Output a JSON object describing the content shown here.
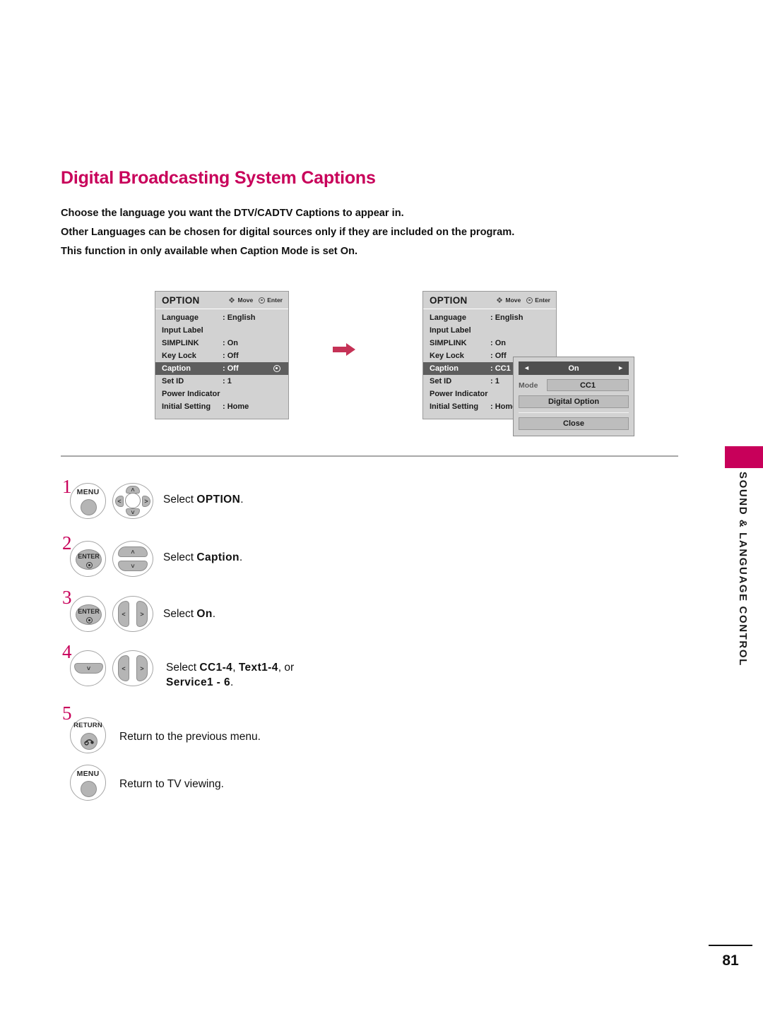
{
  "page": {
    "title": "Digital Broadcasting System Captions",
    "number": "81",
    "sidebar_label": "SOUND & LANGUAGE CONTROL"
  },
  "intro": {
    "line1": "Choose the language you want the DTV/CADTV Captions to appear in.",
    "line2": "Other Languages can be chosen for digital sources only if they are included on the program.",
    "line3_a": "This function in only available when ",
    "line3_b": "Caption",
    "line3_c": " Mode is set ",
    "line3_d": "On",
    "line3_e": "."
  },
  "osd_left": {
    "title": "OPTION",
    "hint_move": "Move",
    "hint_enter": "Enter",
    "rows": [
      {
        "label": "Language",
        "value": ": English"
      },
      {
        "label": "Input Label",
        "value": ""
      },
      {
        "label": "SIMPLINK",
        "value": ": On"
      },
      {
        "label": "Key Lock",
        "value": ": Off"
      },
      {
        "label": "Caption",
        "value": ": Off"
      },
      {
        "label": "Set ID",
        "value": ": 1"
      },
      {
        "label": "Power Indicator",
        "value": ""
      },
      {
        "label": "Initial Setting",
        "value": ": Home"
      }
    ]
  },
  "osd_right": {
    "title": "OPTION",
    "hint_move": "Move",
    "hint_enter": "Enter",
    "rows": [
      {
        "label": "Language",
        "value": ": English"
      },
      {
        "label": "Input Label",
        "value": ""
      },
      {
        "label": "SIMPLINK",
        "value": ": On"
      },
      {
        "label": "Key Lock",
        "value": ": Off"
      },
      {
        "label": "Caption",
        "value": ": CC1"
      },
      {
        "label": "Set ID",
        "value": ": 1"
      },
      {
        "label": "Power Indicator",
        "value": ""
      },
      {
        "label": "Initial Setting",
        "value": ": Home"
      }
    ]
  },
  "popup": {
    "state": "On",
    "arrow_left": "◄",
    "arrow_right": "►",
    "mode_label": "Mode",
    "mode_value": "CC1",
    "digital_option": "Digital Option",
    "close": "Close"
  },
  "steps": [
    {
      "num": "1",
      "key_label": "MENU",
      "text_a": "Select ",
      "text_b": "OPTION",
      "text_c": "."
    },
    {
      "num": "2",
      "key_label": "ENTER",
      "text_a": "Select ",
      "text_b": "Caption",
      "text_c": "."
    },
    {
      "num": "3",
      "key_label": "ENTER",
      "text_a": "Select ",
      "text_b": "On",
      "text_c": "."
    },
    {
      "num": "4",
      "key_label": "",
      "text_a": "Select ",
      "text_b": "CC1-4",
      "text_c": ", ",
      "text_d": "Text1-4",
      "text_e": ", or",
      "text_f": "Service1 - 6",
      "text_g": "."
    },
    {
      "num": "5",
      "key_label": "RETURN",
      "text_a": "Return to the previous menu."
    }
  ],
  "final_key": {
    "label": "MENU",
    "text": "Return to TV viewing."
  },
  "arrow_glyphs": {
    "up": "˄",
    "down": "˅",
    "left": "˂",
    "right": "˃"
  },
  "colors": {
    "brand_magenta": "#c8005a",
    "flow_arrow": "#c53256",
    "osd_bg": "#d2d2d2",
    "osd_selected": "#5e5e5e"
  }
}
